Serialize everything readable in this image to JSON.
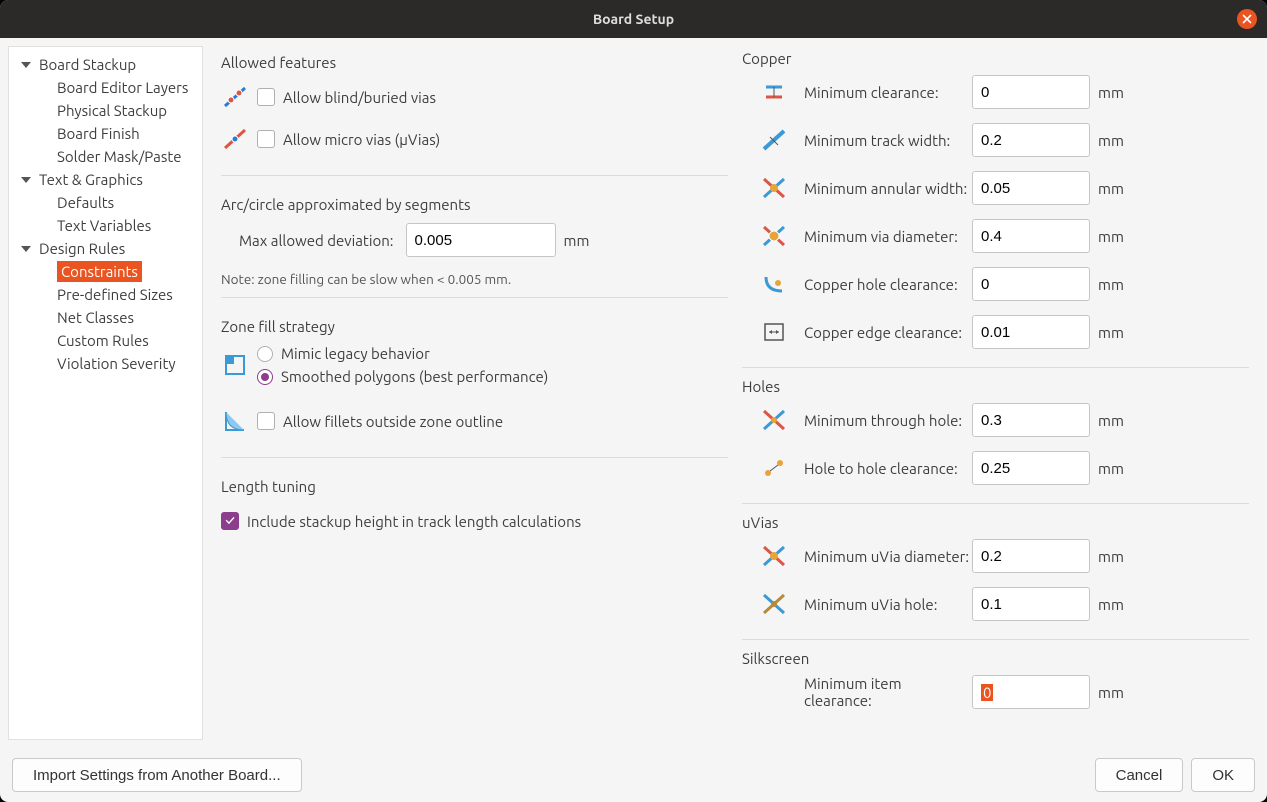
{
  "title": "Board Setup",
  "sidebar": {
    "groups": [
      {
        "label": "Board Stackup",
        "children": [
          "Board Editor Layers",
          "Physical Stackup",
          "Board Finish",
          "Solder Mask/Paste"
        ]
      },
      {
        "label": "Text & Graphics",
        "children": [
          "Defaults",
          "Text Variables"
        ]
      },
      {
        "label": "Design Rules",
        "children": [
          "Constraints",
          "Pre-defined Sizes",
          "Net Classes",
          "Custom Rules",
          "Violation Severity"
        ]
      }
    ],
    "selected": "Constraints"
  },
  "left": {
    "allowed_features": {
      "title": "Allowed features",
      "blind_buried": "Allow blind/buried vias",
      "micro_vias": "Allow micro vias (µVias)"
    },
    "arc": {
      "title": "Arc/circle approximated by segments",
      "max_dev_label": "Max allowed deviation:",
      "max_dev_value": "0.005",
      "unit": "mm",
      "note": "Note: zone filling can be slow when < 0.005 mm."
    },
    "zone": {
      "title": "Zone fill strategy",
      "mimic": "Mimic legacy behavior",
      "smoothed": "Smoothed polygons (best performance)",
      "fillets": "Allow fillets outside zone outline"
    },
    "length": {
      "title": "Length tuning",
      "include": "Include stackup height in track length calculations"
    }
  },
  "right": {
    "unit": "mm",
    "copper": {
      "title": "Copper",
      "rows": [
        {
          "label": "Minimum clearance:",
          "value": "0"
        },
        {
          "label": "Minimum track width:",
          "value": "0.2"
        },
        {
          "label": "Minimum annular width:",
          "value": "0.05"
        },
        {
          "label": "Minimum via diameter:",
          "value": "0.4"
        },
        {
          "label": "Copper hole clearance:",
          "value": "0"
        },
        {
          "label": "Copper edge clearance:",
          "value": "0.01"
        }
      ]
    },
    "holes": {
      "title": "Holes",
      "rows": [
        {
          "label": "Minimum through hole:",
          "value": "0.3"
        },
        {
          "label": "Hole to hole clearance:",
          "value": "0.25"
        }
      ]
    },
    "uvias": {
      "title": "uVias",
      "rows": [
        {
          "label": "Minimum uVia diameter:",
          "value": "0.2"
        },
        {
          "label": "Minimum uVia hole:",
          "value": "0.1"
        }
      ]
    },
    "silk": {
      "title": "Silkscreen",
      "rows": [
        {
          "label": "Minimum item clearance:",
          "value": "0"
        }
      ]
    }
  },
  "footer": {
    "import": "Import Settings from Another Board...",
    "cancel": "Cancel",
    "ok": "OK"
  }
}
